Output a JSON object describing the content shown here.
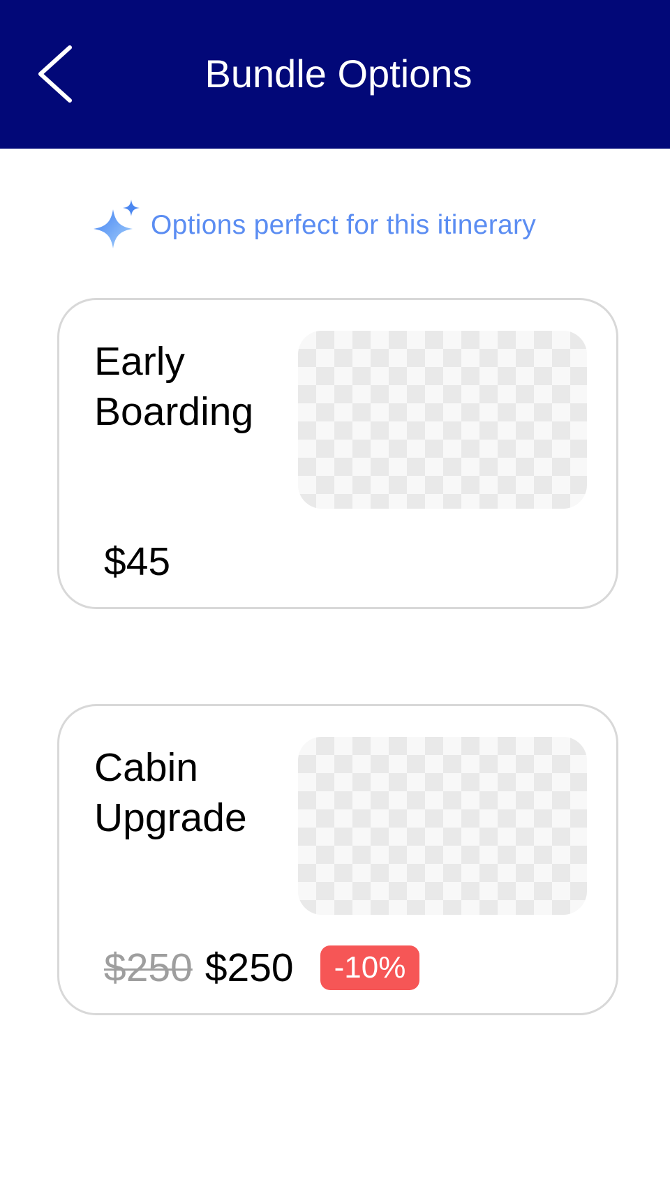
{
  "header": {
    "title": "Bundle Options",
    "back_icon": "chevron-left-icon",
    "background_color": "#020878"
  },
  "tagline": {
    "icon": "sparkle-icon",
    "text": "Options perfect for this itinerary",
    "color": "#5b8df2"
  },
  "bundles": [
    {
      "title": "Early Boarding",
      "price": "$45",
      "image": "image-placeholder"
    },
    {
      "title": "Cabin Upgrade",
      "original_price": "$250",
      "price": "$250",
      "discount": "-10%",
      "discount_color": "#f65656",
      "image": "image-placeholder"
    }
  ]
}
